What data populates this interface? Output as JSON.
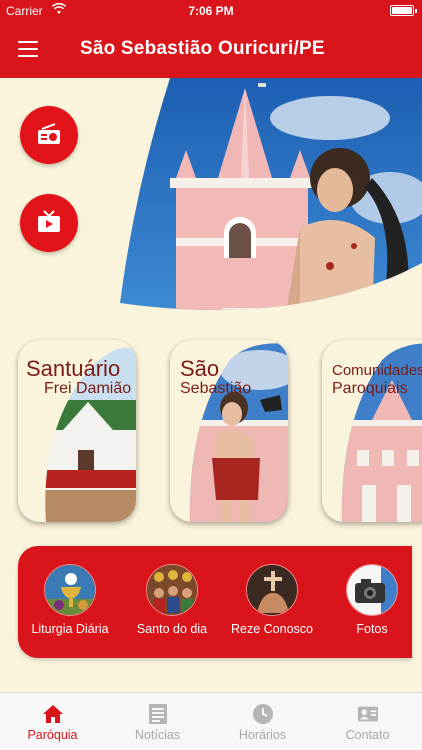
{
  "status_bar": {
    "carrier": "Carrier",
    "time": "7:06 PM"
  },
  "header": {
    "title": "São Sebastião Ouricuri/PE"
  },
  "hero": {
    "radio_icon": "radio-icon",
    "tv_icon": "tv-icon"
  },
  "cards": [
    {
      "line1": "Santuário",
      "line2": "Frei Damião"
    },
    {
      "line1": "São",
      "line2": "Sebastião"
    },
    {
      "line1": "Comunidades",
      "line2": "Paroquiais"
    }
  ],
  "quick_access": [
    {
      "label": "Liturgia Diária",
      "icon": "chalice-icon"
    },
    {
      "label": "Santo do dia",
      "icon": "saints-icon"
    },
    {
      "label": "Reze Conosco",
      "icon": "praying-hands-icon"
    },
    {
      "label": "Fotos",
      "icon": "camera-icon"
    }
  ],
  "tabs": [
    {
      "label": "Paróquia",
      "icon": "home-icon",
      "active": true
    },
    {
      "label": "Notícias",
      "icon": "news-icon",
      "active": false
    },
    {
      "label": "Horários",
      "icon": "clock-icon",
      "active": false
    },
    {
      "label": "Contato",
      "icon": "contact-card-icon",
      "active": false
    }
  ],
  "colors": {
    "primary": "#d9141a",
    "background": "#fbf4dc",
    "card_text": "#7a1c16",
    "tab_inactive": "#a8a8a8"
  }
}
